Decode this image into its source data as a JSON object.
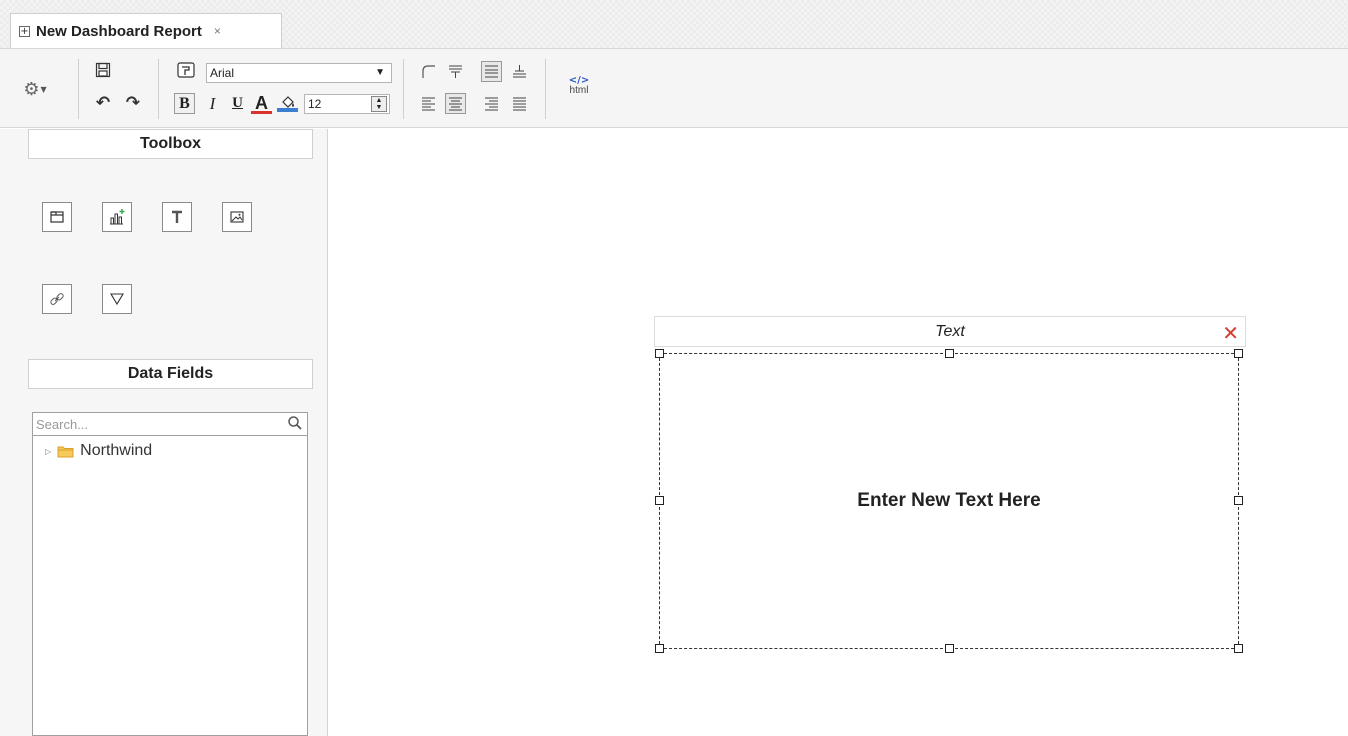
{
  "tab": {
    "title": "New Dashboard Report",
    "close": "×",
    "expand": "+"
  },
  "toolbar": {
    "font_name": "Arial",
    "font_size": "12",
    "bold": "B",
    "italic": "I",
    "underline": "U",
    "font_color_label": "A",
    "font_color": "#d9342b",
    "back_color": "#3a7fd1",
    "html_tag": "</>",
    "html_label": "html"
  },
  "left_panel": {
    "toolbox_title": "Toolbox",
    "datafields_title": "Data Fields",
    "search_placeholder": "Search...",
    "tree": [
      {
        "label": "Northwind",
        "icon": "folder-icon"
      }
    ]
  },
  "widget": {
    "header": "Text",
    "close": "✕",
    "content": "Enter New Text Here",
    "accent": "#d63a2f"
  }
}
